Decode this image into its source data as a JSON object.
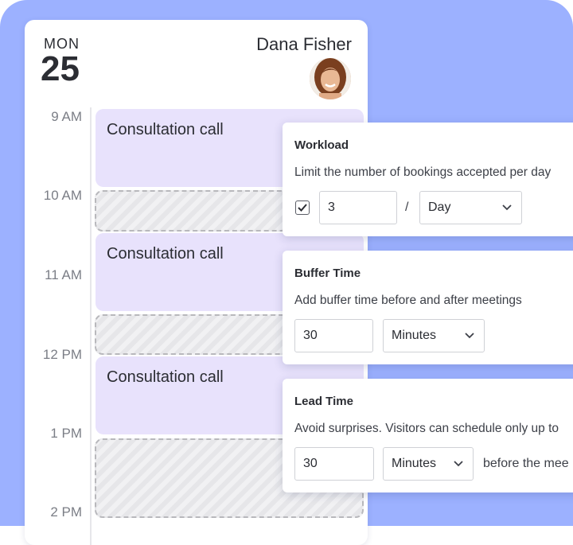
{
  "date": {
    "day_name": "MON",
    "day_number": "25"
  },
  "user": {
    "name": "Dana Fisher"
  },
  "times": [
    "9 AM",
    "10 AM",
    "11 AM",
    "12 PM",
    "1 PM",
    "2 PM"
  ],
  "events": [
    {
      "title": "Consultation call"
    },
    {
      "title": "Consultation call"
    },
    {
      "title": "Consultation call"
    }
  ],
  "workload": {
    "title": "Workload",
    "description": "Limit the number of bookings accepted per day",
    "checked": true,
    "count": "3",
    "separator": "/",
    "period": "Day"
  },
  "buffer_time": {
    "title": "Buffer Time",
    "description": "Add buffer time before and after meetings",
    "value": "30",
    "unit": "Minutes"
  },
  "lead_time": {
    "title": "Lead Time",
    "description": "Avoid surprises. Visitors can schedule only up to",
    "value": "30",
    "unit": "Minutes",
    "suffix": "before the mee"
  },
  "colors": {
    "background": "#9cb1ff",
    "event": "#e8e2fc"
  }
}
